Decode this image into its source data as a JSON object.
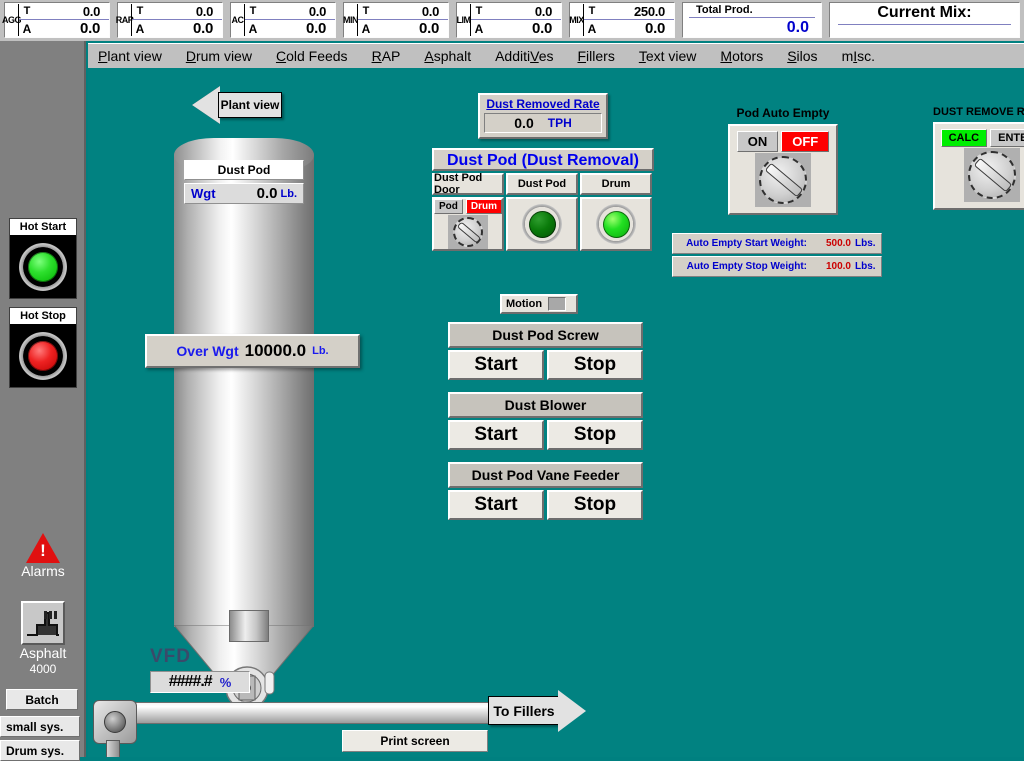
{
  "topbar": {
    "materials": [
      {
        "name": "AGG",
        "target_key": "T",
        "actual_key": "A",
        "target": "0.0",
        "actual": "0.0"
      },
      {
        "name": "RAP",
        "target_key": "T",
        "actual_key": "A",
        "target": "0.0",
        "actual": "0.0"
      },
      {
        "name": "AC",
        "target_key": "T",
        "actual_key": "A",
        "target": "0.0",
        "actual": "0.0"
      },
      {
        "name": "MIN",
        "target_key": "T",
        "actual_key": "A",
        "target": "0.0",
        "actual": "0.0"
      },
      {
        "name": "LIM",
        "target_key": "T",
        "actual_key": "A",
        "target": "0.0",
        "actual": "0.0"
      },
      {
        "name": "MIX",
        "target_key": "T",
        "actual_key": "A",
        "target": "250.0",
        "actual": "0.0"
      }
    ],
    "total_prod_label": "Total Prod.",
    "total_prod_value": "0.0",
    "current_mix_label": "Current Mix:",
    "current_mix_value": ""
  },
  "menu": {
    "items": [
      {
        "pre": "",
        "key": "P",
        "post": "lant view"
      },
      {
        "pre": "",
        "key": "D",
        "post": "rum view"
      },
      {
        "pre": "",
        "key": "C",
        "post": "old Feeds"
      },
      {
        "pre": "",
        "key": "R",
        "post": "AP"
      },
      {
        "pre": "",
        "key": "A",
        "post": "sphalt"
      },
      {
        "pre": "Additi",
        "key": "V",
        "post": "es"
      },
      {
        "pre": "",
        "key": "F",
        "post": "illers"
      },
      {
        "pre": "",
        "key": "T",
        "post": "ext view"
      },
      {
        "pre": "",
        "key": "M",
        "post": "otors"
      },
      {
        "pre": "",
        "key": "S",
        "post": "ilos"
      },
      {
        "pre": "m",
        "key": "I",
        "post": "sc."
      }
    ]
  },
  "sidebar": {
    "hot_start_label": "Hot Start",
    "hot_start_state": "green",
    "hot_stop_label": "Hot Stop",
    "hot_stop_state": "red",
    "alarms_label": "Alarms",
    "plant_label": "Asphalt",
    "plant_sub": "4000",
    "buttons": [
      {
        "label": "Batch"
      },
      {
        "label": "small sys."
      },
      {
        "label": "Drum sys."
      }
    ]
  },
  "canvas": {
    "nav_arrow_label": "Plant view",
    "dust_removed_rate": {
      "title": "Dust Removed Rate",
      "value": "0.0",
      "unit": "TPH"
    },
    "dust_pod_group": {
      "title": "Dust Pod (Dust Removal)",
      "columns": [
        {
          "header": "Dust Pod Door",
          "type": "switch",
          "tag_left": "Pod",
          "tag_right": "Drum",
          "active": "right"
        },
        {
          "header": "Dust Pod",
          "type": "lamp",
          "state": "dark-green"
        },
        {
          "header": "Drum",
          "type": "lamp",
          "state": "bright-green"
        }
      ]
    },
    "pod_auto_empty": {
      "caption": "Pod Auto Empty",
      "tag_left": "ON",
      "tag_right": "OFF",
      "active": "right"
    },
    "dust_remove_rate_switch": {
      "caption": "DUST REMOVE RATE",
      "tag_left": "CALC",
      "tag_right": "ENTER",
      "active": "left"
    },
    "auto_empty": [
      {
        "label": "Auto Empty Start Weight:",
        "value": "500.0",
        "unit": "Lbs."
      },
      {
        "label": "Auto Empty Stop Weight:",
        "value": "100.0",
        "unit": "Lbs."
      }
    ],
    "motion": {
      "label": "Motion"
    },
    "motor_blocks": [
      {
        "title": "Dust Pod Screw",
        "start": "Start",
        "stop": "Stop"
      },
      {
        "title": "Dust Blower",
        "start": "Start",
        "stop": "Stop"
      },
      {
        "title": "Dust Pod Vane Feeder",
        "start": "Start",
        "stop": "Stop"
      }
    ],
    "silo": {
      "label": "Dust Pod",
      "wgt_key": "Wgt",
      "wgt_value": "0.0",
      "wgt_unit": "Lb.",
      "over_key": "Over Wgt",
      "over_value": "10000.0",
      "over_unit": "Lb."
    },
    "vfd": {
      "label": "VFD",
      "value": "####.#",
      "unit": "%"
    },
    "to_fillers_label": "To Fillers",
    "print_screen_label": "Print screen"
  },
  "colors": {
    "teal_background": "#018281",
    "panel_face": "#d4d0c8",
    "accent_blue": "#0000cc",
    "alarm_red": "#cc0000",
    "on_green": "#00ee00",
    "off_red": "#ff0000"
  }
}
